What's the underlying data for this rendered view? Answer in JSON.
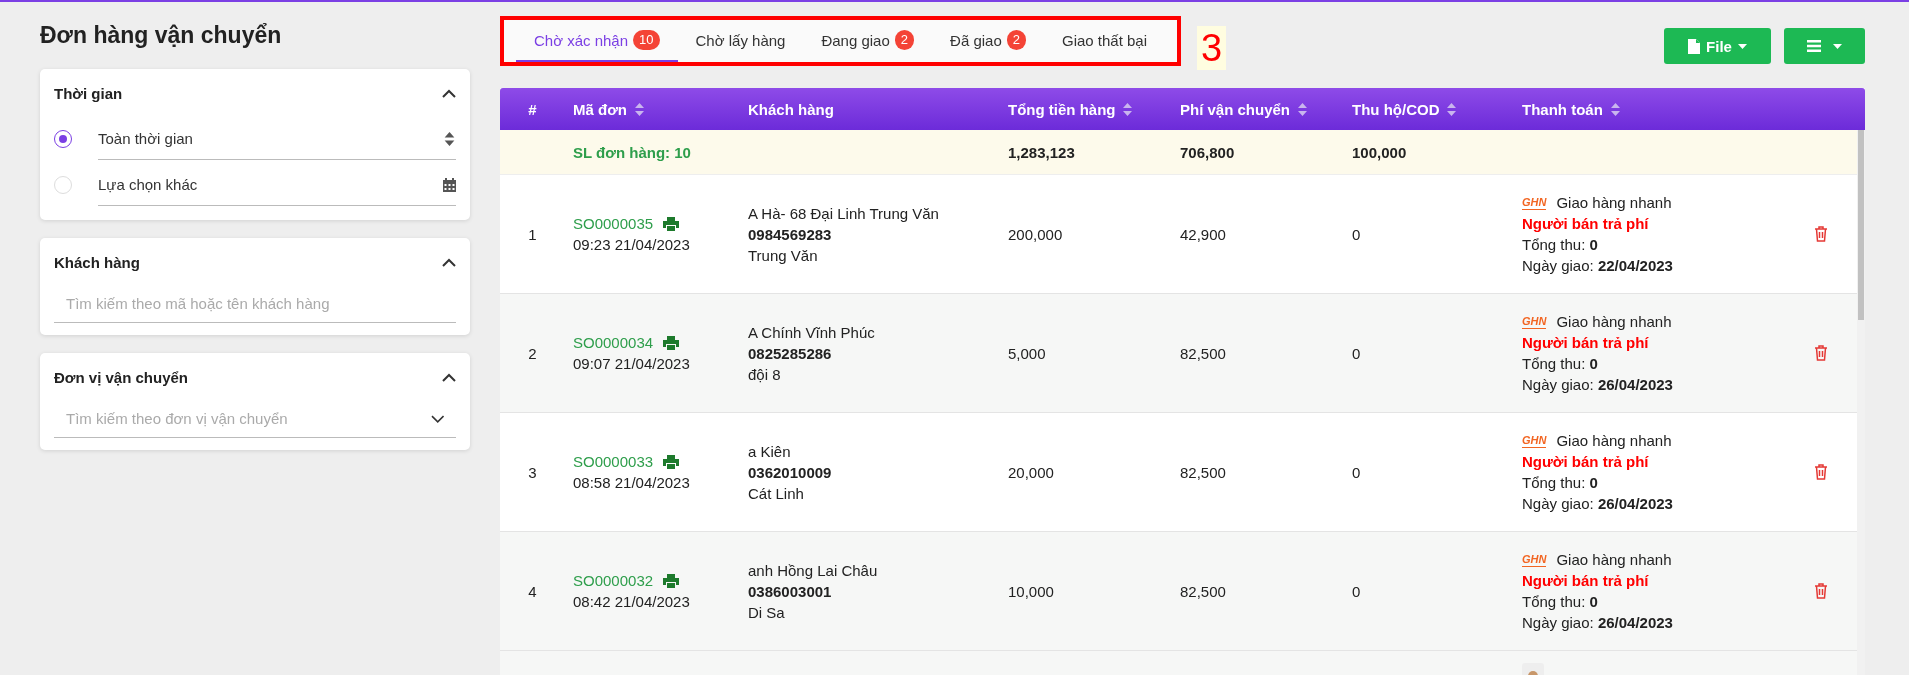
{
  "page": {
    "title": "Đơn hàng vận chuyển"
  },
  "filters": [
    {
      "kind": "time",
      "title": "Thời gian",
      "expanded": true,
      "options": [
        {
          "label": "Toàn thời gian",
          "selected": true
        },
        {
          "label": "Lựa chọn khác",
          "selected": false
        }
      ]
    },
    {
      "kind": "search",
      "title": "Khách hàng",
      "expanded": true,
      "placeholder": "Tìm kiếm theo mã hoặc tên khách hàng"
    },
    {
      "kind": "select",
      "title": "Đơn vị vận chuyển",
      "expanded": true,
      "placeholder": "Tìm kiếm theo đơn vị vận chuyển"
    }
  ],
  "tabs": [
    {
      "label": "Chờ xác nhận",
      "count": "10",
      "selected": true
    },
    {
      "label": "Chờ lấy hàng",
      "selected": false
    },
    {
      "label": "Đang giao",
      "count": "2",
      "selected": false
    },
    {
      "label": "Đã giao",
      "count": "2",
      "selected": false
    },
    {
      "label": "Giao thất bại",
      "selected": false
    }
  ],
  "annotation": {
    "label": "3"
  },
  "toolbar": [
    {
      "kind": "file",
      "label": "File"
    },
    {
      "kind": "menu"
    }
  ],
  "table": {
    "columns": [
      {
        "label": "#",
        "sortable": false
      },
      {
        "label": "Mã đơn",
        "sortable": true
      },
      {
        "label": "Khách hàng",
        "sortable": false
      },
      {
        "label": "Tổng tiền hàng",
        "sortable": true
      },
      {
        "label": "Phí vận chuyển",
        "sortable": true
      },
      {
        "label": "Thu hộ/COD",
        "sortable": true
      },
      {
        "label": "Thanh toán",
        "sortable": true
      }
    ],
    "summary": {
      "label": "SL đơn hàng: 10",
      "total_goods": "1,283,123",
      "shipping_fee": "706,800",
      "cod": "100,000"
    },
    "rows": [
      {
        "index": "1",
        "code": "SO0000035",
        "time": "09:23 21/04/2023",
        "customer_name": "A Hà- 68 Đại Linh Trung Văn",
        "phone": "0984569283",
        "address": "Trung Văn",
        "total_goods": "200,000",
        "shipping_fee": "42,900",
        "cod": "0",
        "carrier_logo": "GHN",
        "carrier": "Giao hàng nhanh",
        "fee_payer": "Người bán trả phí",
        "total_label": "Tổng thu:",
        "total_value": "0",
        "date_label": "Ngày giao:",
        "date_value": "22/04/2023"
      },
      {
        "index": "2",
        "code": "SO0000034",
        "time": "09:07 21/04/2023",
        "customer_name": "A Chính Vĩnh Phúc",
        "phone": "0825285286",
        "address": "đội 8",
        "total_goods": "5,000",
        "shipping_fee": "82,500",
        "cod": "0",
        "carrier_logo": "GHN",
        "carrier": "Giao hàng nhanh",
        "fee_payer": "Người bán trả phí",
        "total_label": "Tổng thu:",
        "total_value": "0",
        "date_label": "Ngày giao:",
        "date_value": "26/04/2023"
      },
      {
        "index": "3",
        "code": "SO0000033",
        "time": "08:58 21/04/2023",
        "customer_name": "a Kiên",
        "phone": "0362010009",
        "address": "Cát Linh",
        "total_goods": "20,000",
        "shipping_fee": "82,500",
        "cod": "0",
        "carrier_logo": "GHN",
        "carrier": "Giao hàng nhanh",
        "fee_payer": "Người bán trả phí",
        "total_label": "Tổng thu:",
        "total_value": "0",
        "date_label": "Ngày giao:",
        "date_value": "26/04/2023"
      },
      {
        "index": "4",
        "code": "SO0000032",
        "time": "08:42 21/04/2023",
        "customer_name": "anh Hồng Lai Châu",
        "phone": "0386003001",
        "address": "Di Sa",
        "total_goods": "10,000",
        "shipping_fee": "82,500",
        "cod": "0",
        "carrier_logo": "GHN",
        "carrier": "Giao hàng nhanh",
        "fee_payer": "Người bán trả phí",
        "total_label": "Tổng thu:",
        "total_value": "0",
        "date_label": "Ngày giao:",
        "date_value": "26/04/2023"
      }
    ]
  }
}
